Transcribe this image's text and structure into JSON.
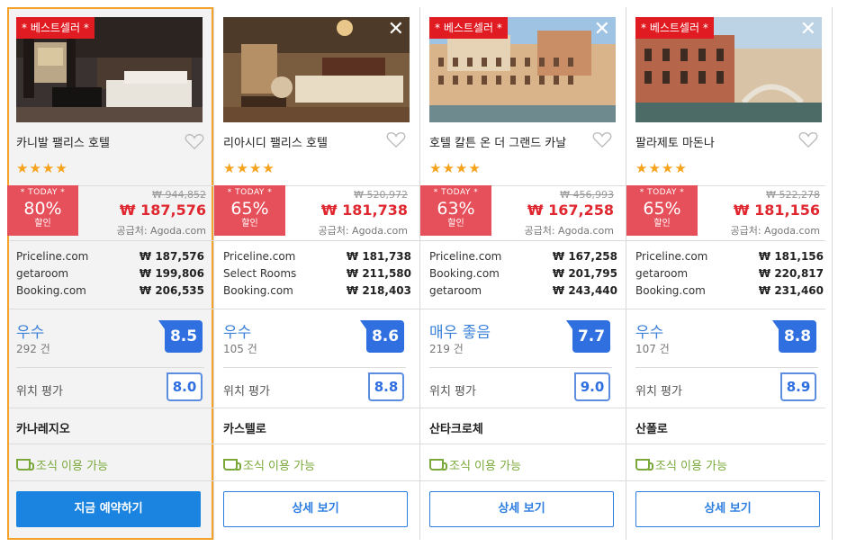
{
  "labels": {
    "bestseller": "* 베스트셀러 *",
    "today": "* TODAY *",
    "discount_word": "할인",
    "supplier": "공급처: Agoda.com",
    "location_label": "위치 평가",
    "breakfast": "조식 이용 가능",
    "close": "✕",
    "stars": "★★★★"
  },
  "colors": {
    "accent_blue": "#1a84e0",
    "deal_red": "#e6505a",
    "price_red": "#e0272f",
    "star_orange": "#f5a21c",
    "selected_border": "#f4a328",
    "breakfast_green": "#7aa83a"
  },
  "hotels": [
    {
      "name": "카니발 팰리스 호텔",
      "discount": "80%",
      "old_price": "₩ 944,852",
      "price": "₩ 187,576",
      "providers": [
        {
          "name": "Priceline.com",
          "price": "₩ 187,576"
        },
        {
          "name": "getaroom",
          "price": "₩ 199,806"
        },
        {
          "name": "Booking.com",
          "price": "₩ 206,535"
        }
      ],
      "rating_text": "우수",
      "review_count": "292 건",
      "score": "8.5",
      "location_score": "8.0",
      "area": "카나레지오",
      "button": "지금 예약하기",
      "selected": true
    },
    {
      "name": "리아시디 팰리스 호텔",
      "discount": "65%",
      "old_price": "₩ 520,972",
      "price": "₩ 181,738",
      "providers": [
        {
          "name": "Priceline.com",
          "price": "₩ 181,738"
        },
        {
          "name": "Select Rooms",
          "price": "₩ 211,580"
        },
        {
          "name": "Booking.com",
          "price": "₩ 218,403"
        }
      ],
      "rating_text": "우수",
      "review_count": "105 건",
      "score": "8.6",
      "location_score": "8.8",
      "area": "카스텔로",
      "button": "상세 보기"
    },
    {
      "name": "호텔 칼튼 온 더 그랜드 카날",
      "discount": "63%",
      "old_price": "₩ 456,993",
      "price": "₩ 167,258",
      "providers": [
        {
          "name": "Priceline.com",
          "price": "₩ 167,258"
        },
        {
          "name": "Booking.com",
          "price": "₩ 201,795"
        },
        {
          "name": "getaroom",
          "price": "₩ 243,440"
        }
      ],
      "rating_text": "매우 좋음",
      "review_count": "219 건",
      "score": "7.7",
      "location_score": "9.0",
      "area": "산타크로체",
      "button": "상세 보기"
    },
    {
      "name": "팔라제토 마돈나",
      "discount": "65%",
      "old_price": "₩ 522,278",
      "price": "₩ 181,156",
      "providers": [
        {
          "name": "Priceline.com",
          "price": "₩ 181,156"
        },
        {
          "name": "getaroom",
          "price": "₩ 220,817"
        },
        {
          "name": "Booking.com",
          "price": "₩ 231,460"
        }
      ],
      "rating_text": "우수",
      "review_count": "107 건",
      "score": "8.8",
      "location_score": "8.9",
      "area": "산폴로",
      "button": "상세 보기"
    }
  ]
}
